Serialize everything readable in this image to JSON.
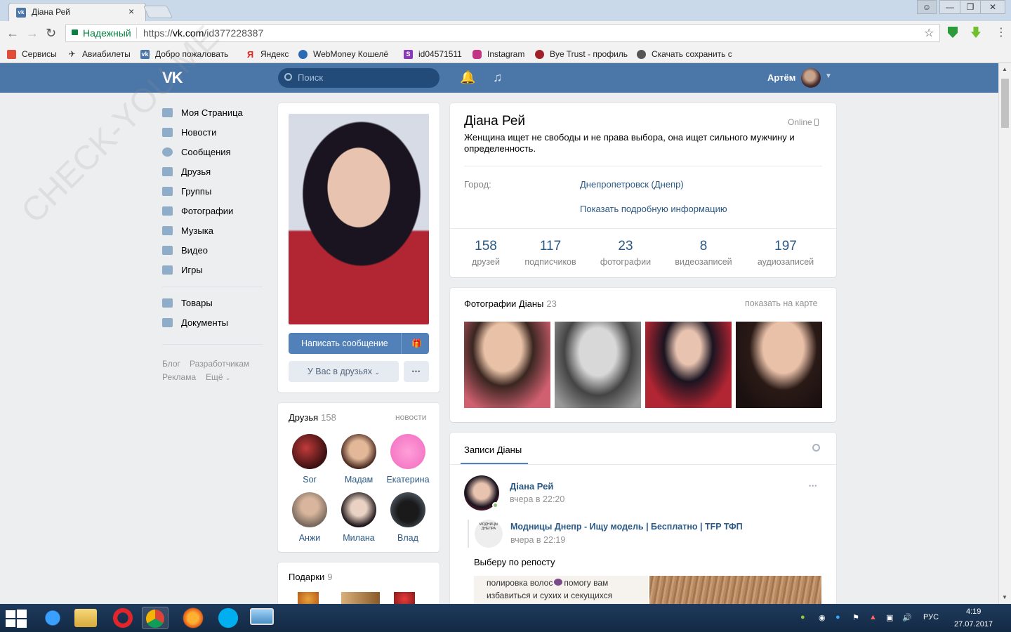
{
  "browser": {
    "tab_title": "Діана Рей",
    "tab_close": "×",
    "security_label": "Надежный",
    "url_scheme": "https://",
    "url_host": "vk.com",
    "url_path": "/id377228387"
  },
  "bookmarks": [
    {
      "label": "Сервисы",
      "color": "#e04b3a"
    },
    {
      "label": "Авиабилеты",
      "color": "#333333"
    },
    {
      "label": "Добро пожаловать",
      "color": "#4a76a8"
    },
    {
      "label": "Яндекс",
      "color": "#e52620"
    },
    {
      "label": "WebMoney Кошелё",
      "color": "#2d6ab4"
    },
    {
      "label": "id04571511",
      "color": "#8a3ab9"
    },
    {
      "label": "Instagram",
      "color": "#c13584"
    },
    {
      "label": "Bye Trust - профиль",
      "color": "#a0202a"
    },
    {
      "label": "Скачать сохранить с",
      "color": "#555555"
    }
  ],
  "vk_header": {
    "logo": "VK",
    "search_placeholder": "Поиск",
    "user_name": "Артём"
  },
  "left_menu": {
    "items": [
      "Моя Страница",
      "Новости",
      "Сообщения",
      "Друзья",
      "Группы",
      "Фотографии",
      "Музыка",
      "Видео",
      "Игры"
    ],
    "items2": [
      "Товары",
      "Документы"
    ],
    "footer": [
      "Блог",
      "Разработчикам",
      "Реклама",
      "Ещё"
    ]
  },
  "profile": {
    "name": "Діана Рей",
    "online": "Online",
    "status": "Женщина ищет не свободы и не права выбора, она ищет сильного мужчину и определенность.",
    "city_label": "Город:",
    "city_value": "Днепропетровск (Днепр)",
    "more_info": "Показать подробную информацию",
    "send_message": "Написать сообщение",
    "friend_status": "У Вас в друзьях",
    "more_btn": "•••",
    "counters": [
      {
        "n": "158",
        "t": "друзей"
      },
      {
        "n": "117",
        "t": "подписчиков"
      },
      {
        "n": "23",
        "t": "фотографии"
      },
      {
        "n": "8",
        "t": "видеозаписей"
      },
      {
        "n": "197",
        "t": "аудиозаписей"
      }
    ]
  },
  "photos": {
    "title": "Фотографии Діаны",
    "count": "23",
    "map_link": "показать на карте"
  },
  "friends": {
    "title": "Друзья",
    "count": "158",
    "news_link": "новости",
    "list": [
      "Sor",
      "Мадам",
      "Екатерина",
      "Анжи",
      "Милана",
      "Влад"
    ]
  },
  "gifts": {
    "title": "Подарки",
    "count": "9"
  },
  "wall": {
    "tab": "Записи Діаны",
    "post_author": "Діана Рей",
    "post_time": "вчера в 22:20",
    "repost_author": "Модницы Днепр - Ищу модель | Бесплатно | TFP ТФП",
    "repost_time": "вчера в 22:19",
    "repost_avatar_text": "МОДНИЦЫ ДНЕПРА",
    "repost_text": "Выберу по репосту",
    "image_text_line1": "полировка волос",
    "image_text_line1b": "помогу вам",
    "image_text_line2": "избавиться и сухих и секущихся",
    "more": "•••"
  },
  "taskbar": {
    "lang": "РУС",
    "time": "4:19",
    "date": "27.07.2017"
  },
  "watermark": "CHECK-YOU.ME"
}
